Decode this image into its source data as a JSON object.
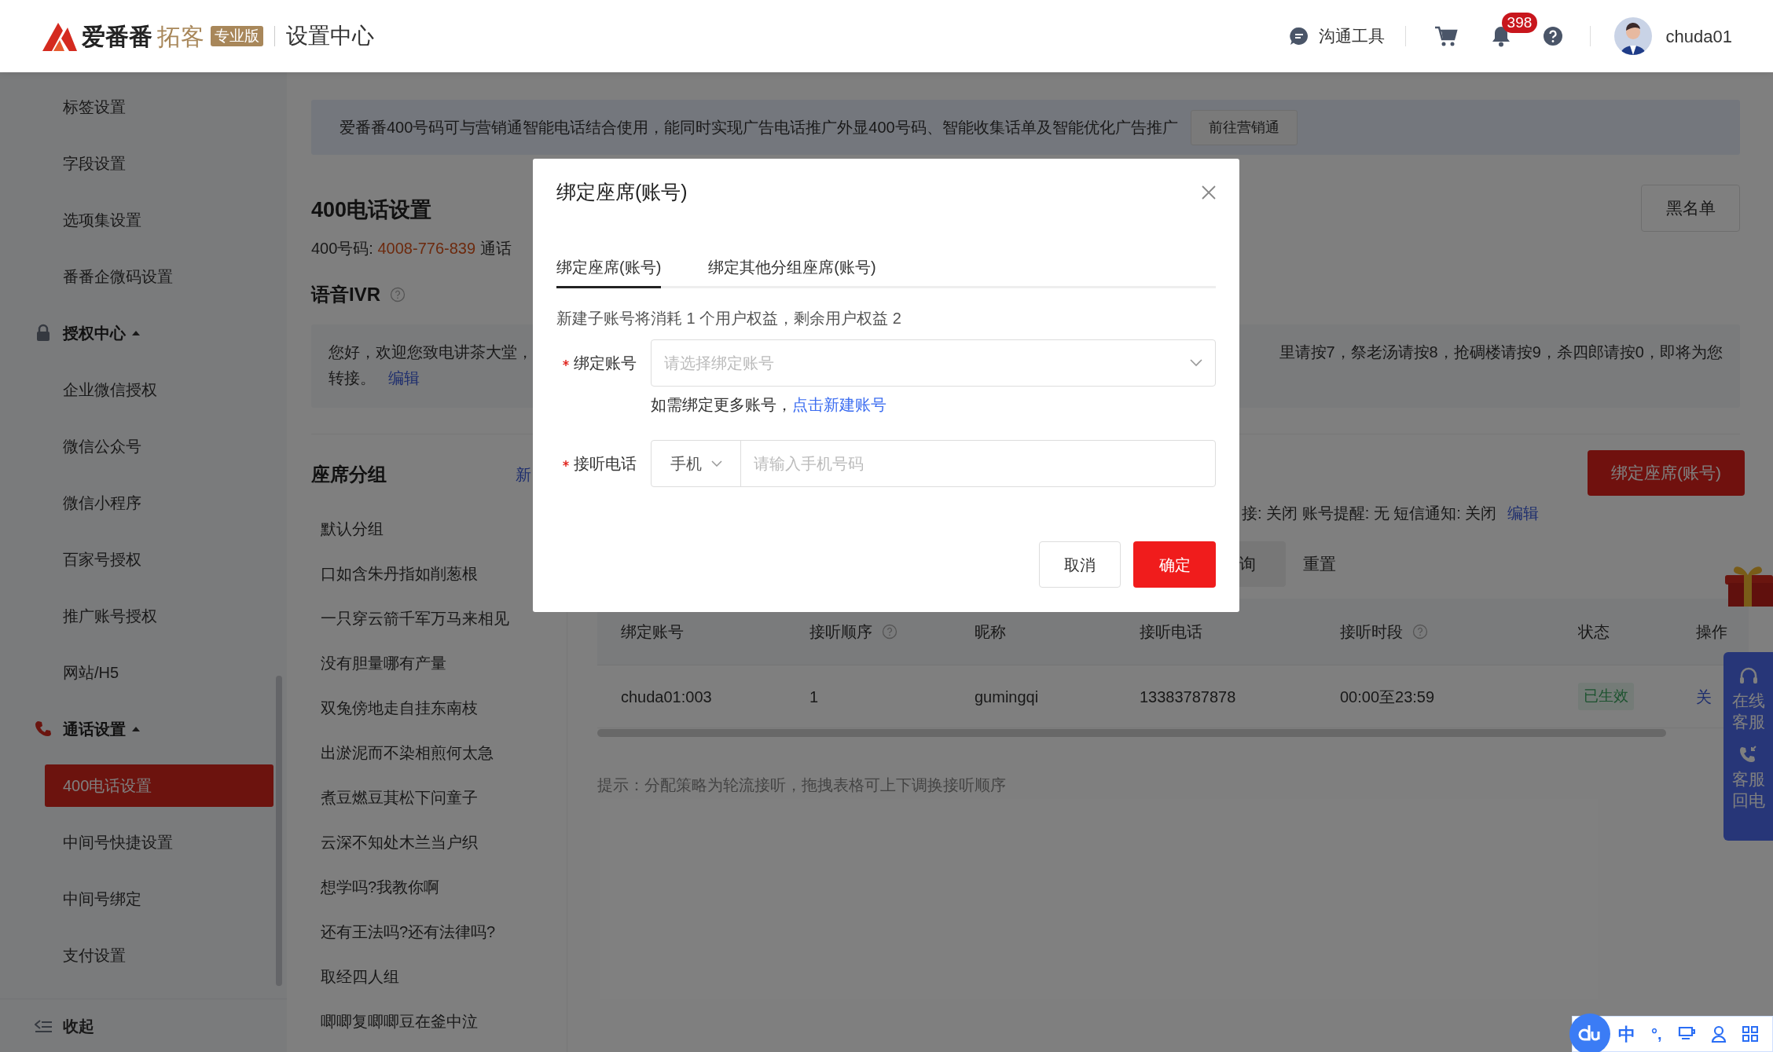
{
  "header": {
    "logo": {
      "brand": "爱番番",
      "product": "拓客",
      "edition": "专业版"
    },
    "title": "设置中心",
    "tool": "沟通工具",
    "notifications": "398",
    "user": "chuda01"
  },
  "sidebar": {
    "items": [
      {
        "kind": "item",
        "label": "标签设置",
        "selected": false
      },
      {
        "kind": "item",
        "label": "字段设置",
        "selected": false
      },
      {
        "kind": "item",
        "label": "选项集设置",
        "selected": false
      },
      {
        "kind": "item",
        "label": "番番企微码设置",
        "selected": false
      },
      {
        "kind": "section",
        "label": "授权中心",
        "expanded": true,
        "children": [
          {
            "label": "企业微信授权",
            "selected": false
          },
          {
            "label": "微信公众号",
            "selected": false
          },
          {
            "label": "微信小程序",
            "selected": false
          },
          {
            "label": "百家号授权",
            "selected": false
          },
          {
            "label": "推广账号授权",
            "selected": false
          },
          {
            "label": "网站/H5",
            "selected": false
          }
        ]
      },
      {
        "kind": "section",
        "label": "通话设置",
        "expanded": true,
        "children": [
          {
            "label": "400电话设置",
            "selected": true
          },
          {
            "label": "中间号快捷设置",
            "selected": false
          },
          {
            "label": "中间号绑定",
            "selected": false
          },
          {
            "label": "支付设置",
            "selected": false
          }
        ]
      }
    ],
    "collapse": "收起"
  },
  "banner": {
    "text": "爱番番400号码可与营销通智能电话结合使用，能同时实现广告电话推广外显400号码、智能收集话单及智能优化广告推广",
    "button": "前往营销通"
  },
  "page_title": "400电话设置",
  "blacklist_button": "黑名单",
  "number_line": {
    "label": "400号码: ",
    "number": "4008-776-839",
    "rest": "通话"
  },
  "ivr": {
    "title": "语音IVR",
    "text_left": "您好，欢迎您致电讲茶大堂，",
    "text_right": "里请按7，祭老汤请按8，抢碉楼请按9，杀四郎请按0，即将为您",
    "line2": "转接。",
    "edit": "编辑"
  },
  "groups": {
    "title": "座席分组",
    "new_link": "新",
    "items": [
      "默认分组",
      "口如含朱丹指如削葱根",
      "一只穿云箭千军万马来相见",
      "没有胆量哪有产量",
      "双兔傍地走自挂东南枝",
      "出淤泥而不染相煎何太急",
      "煮豆燃豆萁松下问童子",
      "云深不知处木兰当户织",
      "想学吗?我教你啊",
      "还有王法吗?还有法律吗?",
      "取经四人组",
      "唧唧复唧唧豆在釜中泣"
    ]
  },
  "seats": {
    "bind_button": "绑定座席(账号)",
    "settings": "接: 关闭 账号提醒: 无 短信通知: 关闭",
    "edit": "编辑",
    "query_button": "询",
    "reset_button": "重置",
    "table": {
      "columns": [
        {
          "label": "绑定账号",
          "help": false
        },
        {
          "label": "接听顺序",
          "help": true
        },
        {
          "label": "昵称",
          "help": false
        },
        {
          "label": "接听电话",
          "help": false
        },
        {
          "label": "接听时段",
          "help": true
        },
        {
          "label": "状态",
          "help": false
        },
        {
          "label": "操作",
          "help": false
        }
      ],
      "rows": [
        {
          "account": "chuda01:003",
          "order": "1",
          "nickname": "gumingqi",
          "phone": "13383787878",
          "period": "00:00至23:59",
          "status": "已生效",
          "action": "关"
        }
      ]
    },
    "hint": "提示：分配策略为轮流接听，拖拽表格可上下调换接听顺序"
  },
  "float_service": [
    "在线客服",
    "客服回电"
  ],
  "ime": {
    "mode": "中",
    "punct": "°,"
  },
  "dialog": {
    "title": "绑定座席(账号)",
    "tabs": [
      {
        "label": "绑定座席(账号)",
        "selected": true
      },
      {
        "label": "绑定其他分组座席(账号)",
        "selected": false
      }
    ],
    "note": "新建子账号将消耗 1 个用户权益，剩余用户权益 2",
    "account": {
      "label": "绑定账号",
      "required": true,
      "placeholder": "请选择绑定账号"
    },
    "help": {
      "text": "如需绑定更多账号，",
      "link": "点击新建账号"
    },
    "phone": {
      "label": "接听电话",
      "required": true,
      "type": "手机",
      "placeholder": "请输入手机号码"
    },
    "cancel": "取消",
    "ok": "确定"
  }
}
